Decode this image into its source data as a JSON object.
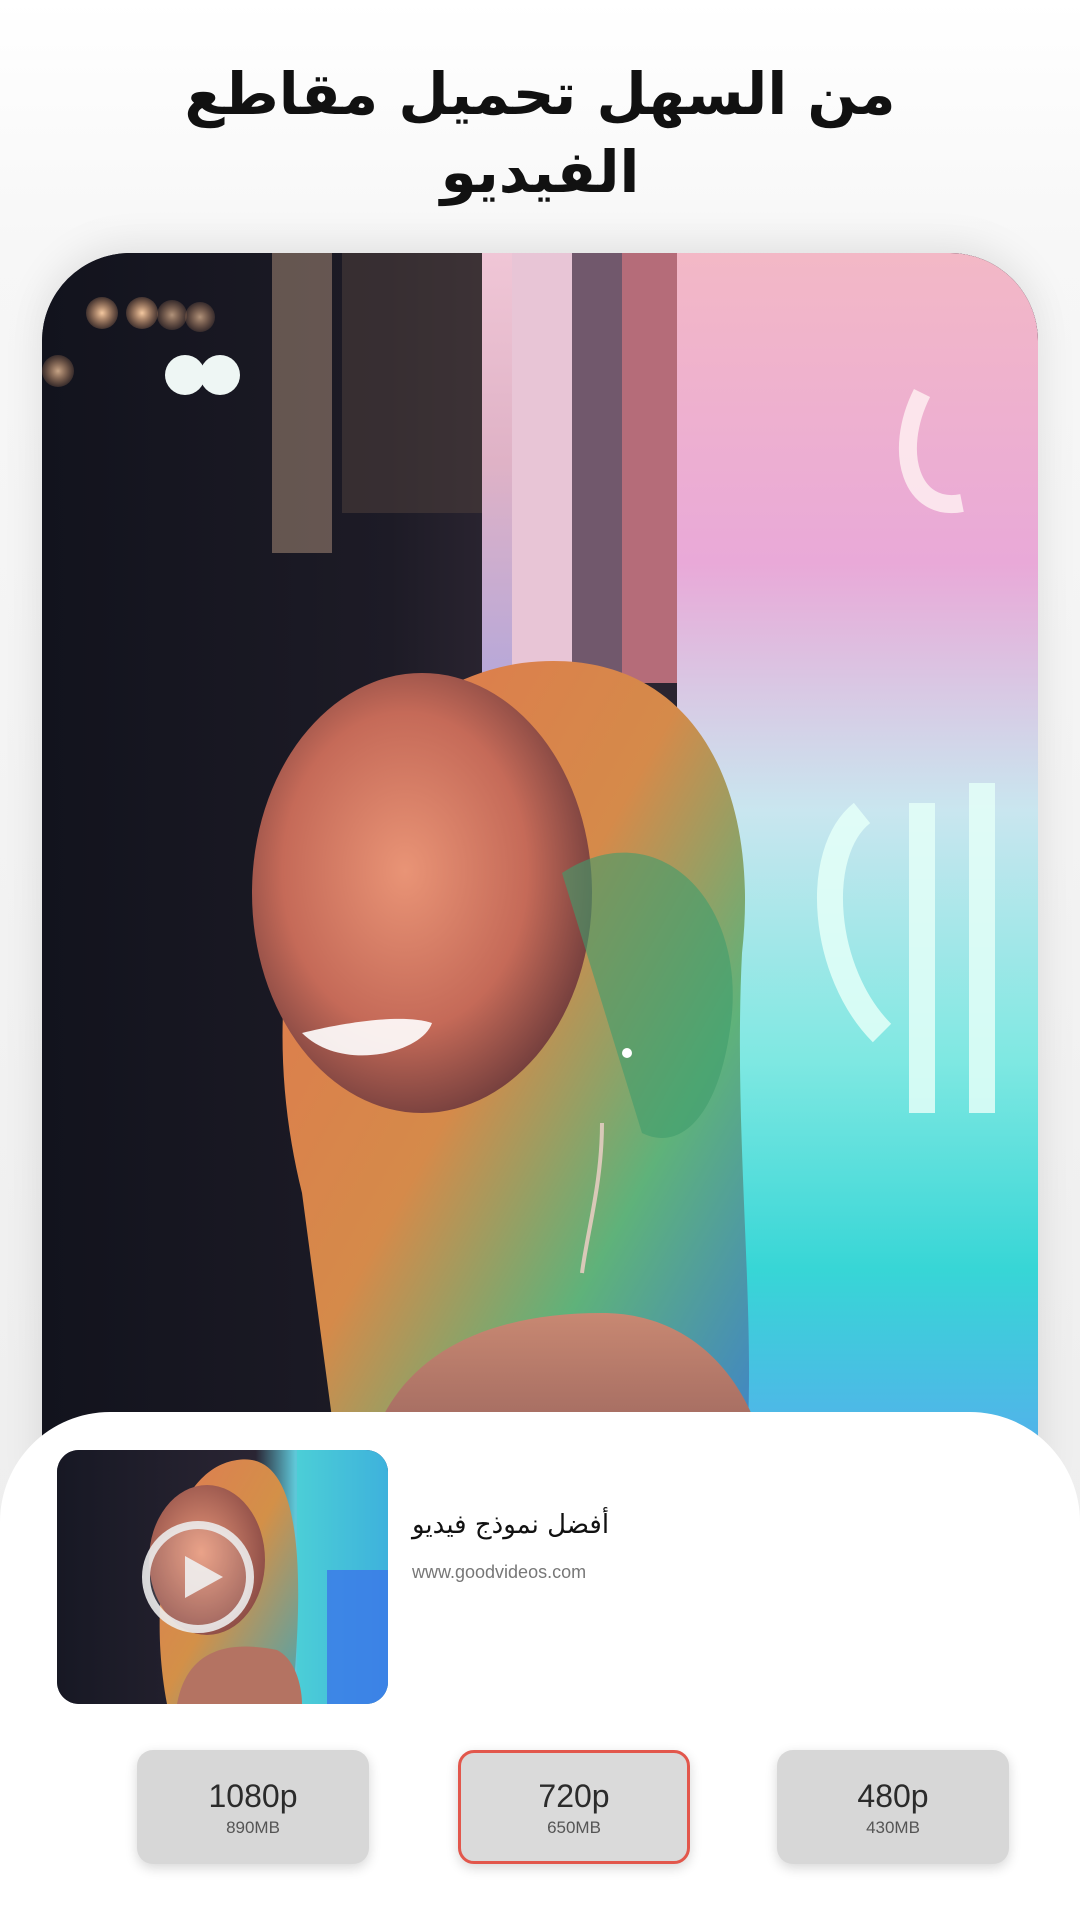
{
  "headline": {
    "line1": "من السهل تحميل مقاطع",
    "line2": "الفيديو"
  },
  "video": {
    "title": "أفضل نموذج فيديو",
    "url": "www.goodvideos.com",
    "thumbnail_icon": "play-icon"
  },
  "quality_options": [
    {
      "resolution": "1080p",
      "size": "890MB",
      "selected": false
    },
    {
      "resolution": "720p",
      "size": "650MB",
      "selected": true
    },
    {
      "resolution": "480p",
      "size": "430MB",
      "selected": false
    }
  ],
  "colors": {
    "accent": "#e2574c",
    "option_bg": "#d7d7d7",
    "headline": "#111111"
  }
}
